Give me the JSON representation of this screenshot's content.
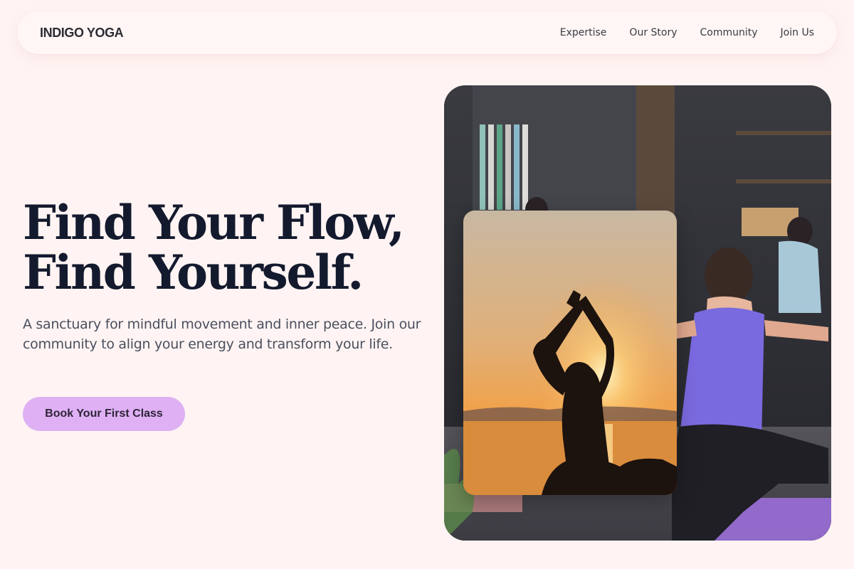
{
  "brand": {
    "name": "INDIGO YOGA"
  },
  "nav": {
    "items": [
      {
        "label": "Expertise"
      },
      {
        "label": "Our Story"
      },
      {
        "label": "Community"
      },
      {
        "label": "Join Us"
      }
    ]
  },
  "hero": {
    "title_line1": "Find Your Flow,",
    "title_line2": "Find Yourself.",
    "subtitle": "A sanctuary for mindful movement and inner peace. Join our community to align your energy and transform your life.",
    "cta_label": "Book Your First Class"
  },
  "images": {
    "main": {
      "icon": "group-yoga-class-photo"
    },
    "inset": {
      "icon": "sunset-yoga-silhouette-photo"
    }
  },
  "colors": {
    "background": "#fff4f3",
    "navbar": "#fff6f5",
    "title": "#141a2e",
    "subtitle": "#4a4f5e",
    "cta_bg": "#dfb0f4",
    "cta_text": "#2e2438"
  }
}
